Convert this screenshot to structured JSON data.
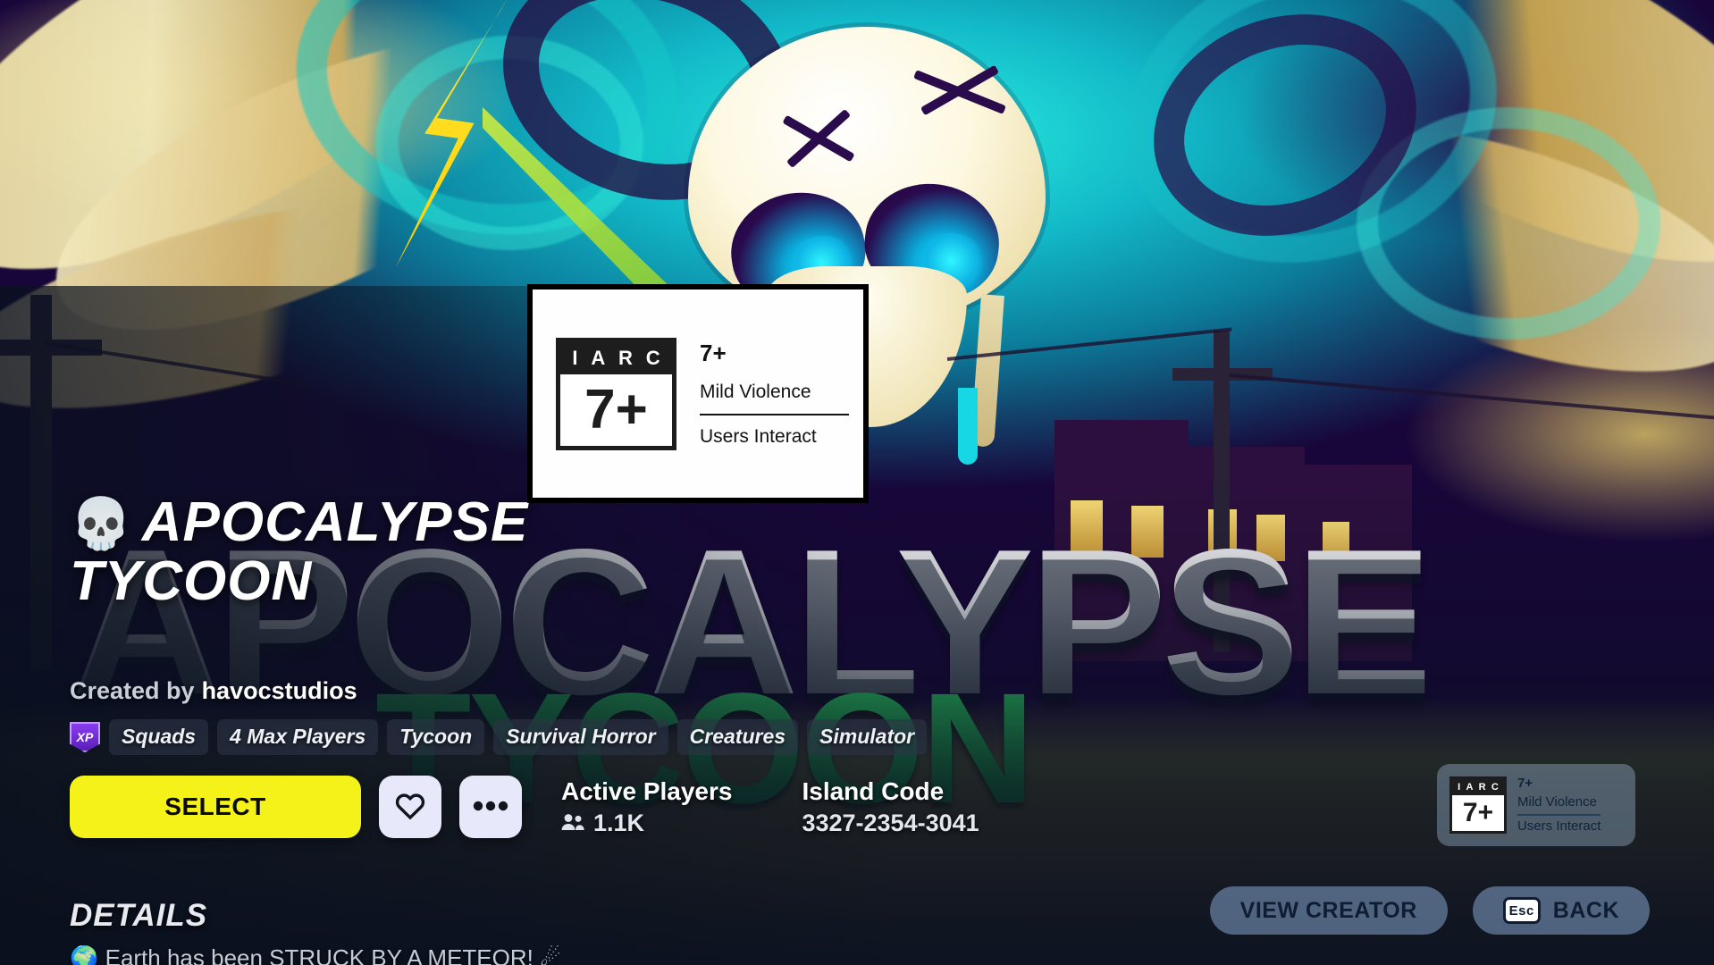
{
  "page": {
    "island_title_line1": "APOCALYPSE",
    "island_title_line2": "TYCOON",
    "skull_emoji": "💀",
    "backdrop_word_1": "APOCALYPSE",
    "backdrop_word_2": "TYCOON"
  },
  "creator": {
    "prefix": "Created by",
    "name": "havocstudios"
  },
  "tags": {
    "xp_label": "XP",
    "items": [
      "Squads",
      "4 Max Players",
      "Tycoon",
      "Survival Horror",
      "Creatures",
      "Simulator"
    ]
  },
  "actions": {
    "select_label": "SELECT",
    "favorite_icon": "heart-icon",
    "more_icon": "ellipsis-icon"
  },
  "stats": [
    {
      "label": "Active Players",
      "value": "1.1K",
      "icon": "people-icon"
    },
    {
      "label": "Island Code",
      "value": "3327-2354-3041",
      "icon": ""
    }
  ],
  "details": {
    "heading": "DETAILS",
    "body": "🌍 Earth has been STRUCK BY A METEOR! ☄"
  },
  "rating_modal": {
    "iarc_label_letters": [
      "I",
      "A",
      "R",
      "C"
    ],
    "iarc_age": "7+",
    "age_heading": "7+",
    "descriptor_1": "Mild Violence",
    "descriptor_2": "Users Interact"
  },
  "rating_badge": {
    "iarc_label_letters": [
      "I",
      "A",
      "R",
      "C"
    ],
    "iarc_age": "7+",
    "age_heading": "7+",
    "descriptor_1": "Mild Violence",
    "descriptor_2": "Users Interact"
  },
  "bottom_buttons": {
    "view_creator": "VIEW CREATOR",
    "back": "BACK",
    "esc_key": "Esc"
  },
  "colors": {
    "select_button": "#f5f21a",
    "select_text": "#0a0a0a",
    "pill": "#83a4cd",
    "xp_badge": "#8a3cf0"
  }
}
